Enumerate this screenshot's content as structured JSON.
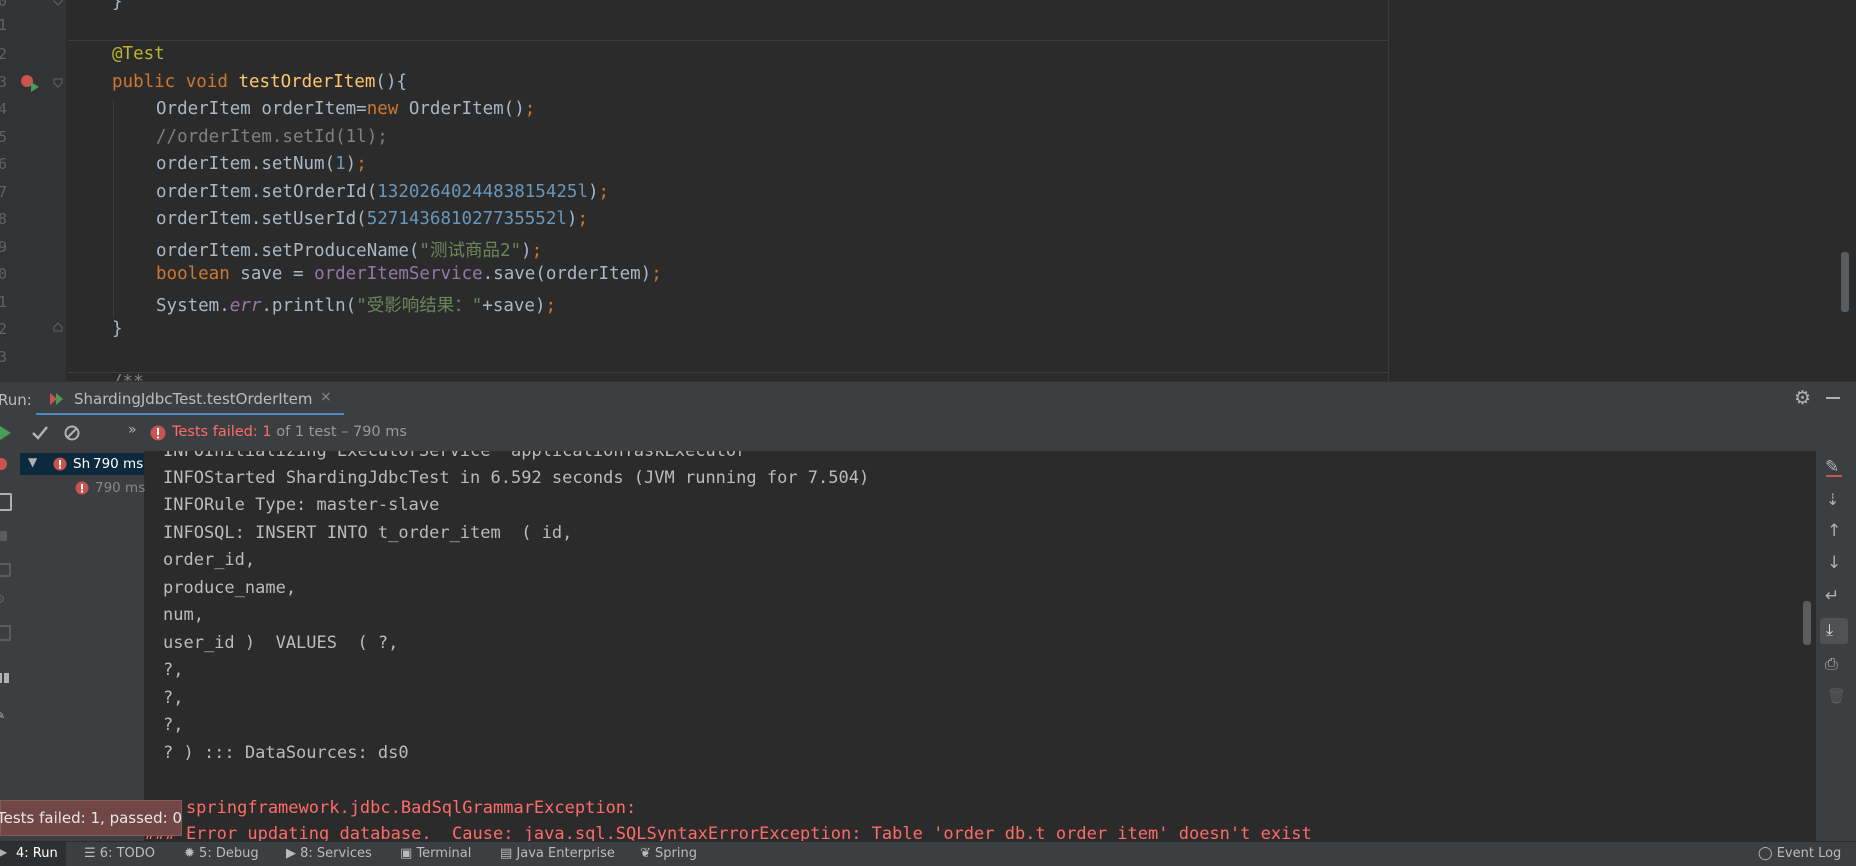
{
  "editor": {
    "line_numbers": [
      "0",
      "1",
      "2",
      "3",
      "4",
      "5",
      "6",
      "7",
      "8",
      "9",
      "0",
      "1",
      "2",
      "3"
    ],
    "lines": {
      "l0": "}",
      "l2_ann": "@Test",
      "l3_kw": "public void ",
      "l3_fn": "testOrderItem",
      "l3_rest": "(){",
      "l4_a": "OrderItem orderItem=",
      "l4_kw": "new",
      "l4_b": " OrderItem()",
      "l4_c": ";",
      "l5_cmt": "//orderItem.setId(1l);",
      "l6_a": "orderItem.setNum(",
      "l6_num": "1",
      "l6_b": ")",
      "l6_c": ";",
      "l7_a": "orderItem.setOrderId(",
      "l7_num": "1320264024483815425l",
      "l7_b": ")",
      "l7_c": ";",
      "l8_a": "orderItem.setUserId(",
      "l8_num": "527143681027735552l",
      "l8_b": ")",
      "l8_c": ";",
      "l9_a": "orderItem.setProduceName(",
      "l9_str": "\"测试商品2\"",
      "l9_b": ")",
      "l9_c": ";",
      "l10_kw": "boolean",
      "l10_a": " save = ",
      "l10_fld": "orderItemService",
      "l10_b": ".save(orderItem)",
      "l10_c": ";",
      "l11_a": "System.",
      "l11_it": "err",
      "l11_b": ".println(",
      "l11_str": "\"受影响结果：\"",
      "l11_c": "+save)",
      "l11_d": ";",
      "l12": "}",
      "l14_partial": "/**"
    }
  },
  "run_panel": {
    "label": "Run:",
    "tab_title": "ShardingJdbcTest.testOrderItem",
    "status_prefix": "Tests failed: ",
    "status_count": "1",
    "status_rest": " of 1 test – 790 ms",
    "tree_root_label": "Sh",
    "tree_root_time": "790 ms",
    "tree_child_time": "790 ms"
  },
  "console": {
    "lines": [
      "INFOInitializing ExecutorService 'applicationTaskExecutor'",
      "INFOStarted ShardingJdbcTest in 6.592 seconds (JVM running for 7.504)",
      "INFORule Type: master-slave",
      "INFOSQL: INSERT INTO t_order_item  ( id,",
      "order_id,",
      "produce_name,",
      "num,",
      "user_id )  VALUES  ( ?,",
      "?,",
      "?,",
      "?,",
      "? ) ::: DataSources: ds0"
    ],
    "error_1": "org.springframework.jdbc.BadSqlGrammarException:",
    "error_2": "### Error updating database.  Cause: java.sql.SQLSyntaxErrorException: Table 'order_db.t_order_item' doesn't exist"
  },
  "toast": {
    "text": "Tests failed: 1, passed: 0"
  },
  "status_bar": {
    "run": "4: Run",
    "todo": "6: TODO",
    "debug": "5: Debug",
    "services": "8: Services",
    "terminal": "Terminal",
    "java_enterprise": "Java Enterprise",
    "spring": "Spring",
    "event_log": "Event Log"
  },
  "colors": {
    "editor_bg": "#2b2b2b",
    "panel_bg": "#3c3f41",
    "error": "#ff6b68",
    "keyword": "#cc7832",
    "string": "#6a8759",
    "number": "#6897bb"
  }
}
